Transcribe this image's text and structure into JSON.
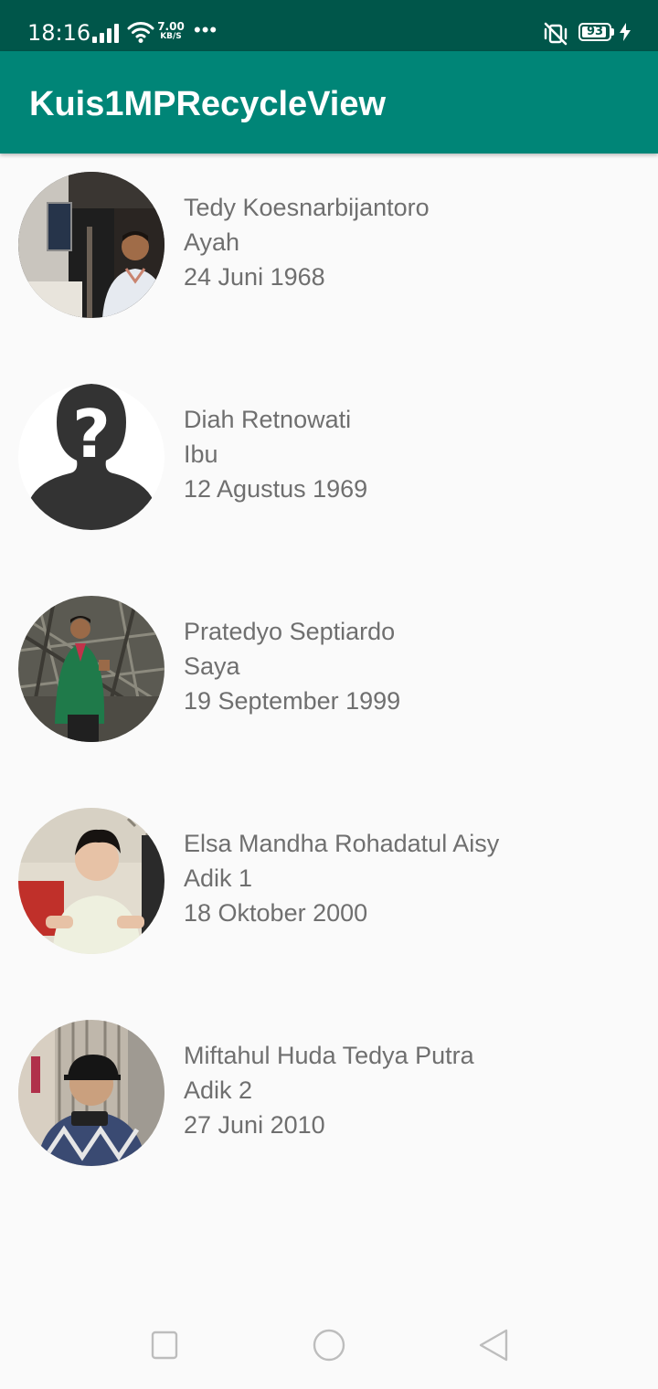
{
  "status_bar": {
    "time": "18:16",
    "net_speed_value": "7.00",
    "net_speed_unit": "KB/S",
    "overflow": "•••",
    "battery_level": "93",
    "icons": [
      "signal-icon",
      "wifi-icon",
      "vibrate-off-icon",
      "battery-icon",
      "charging-icon"
    ]
  },
  "app_bar": {
    "title": "Kuis1MPRecycleView"
  },
  "items": [
    {
      "name": "Tedy Koesnarbijantoro",
      "role": "Ayah",
      "date": "24 Juni 1968",
      "avatar": "photo-man-lobby"
    },
    {
      "name": "Diah Retnowati",
      "role": "Ibu",
      "date": "12 Agustus 1969",
      "avatar": "unknown-person-placeholder"
    },
    {
      "name": "Pratedyo Septiardo",
      "role": "Saya",
      "date": "19 September 1999",
      "avatar": "photo-man-green-jacket"
    },
    {
      "name": "Elsa Mandha Rohadatul Aisy",
      "role": "Adik 1",
      "date": "18 Oktober 2000",
      "avatar": "photo-baby"
    },
    {
      "name": "Miftahul Huda Tedya Putra",
      "role": "Adik 2",
      "date": "27 Juni 2010",
      "avatar": "photo-child-cap"
    }
  ],
  "nav_bar": {
    "icons": [
      "recents-square-icon",
      "home-circle-icon",
      "back-triangle-icon"
    ]
  },
  "colors": {
    "status_bar": "#00564a",
    "app_bar": "#008577",
    "background": "#fafafa",
    "item_text": "#6f6f6f"
  }
}
